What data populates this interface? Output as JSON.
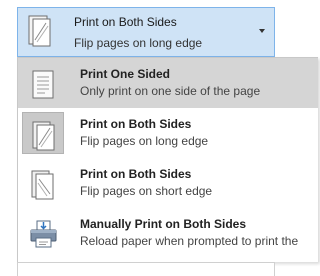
{
  "dropdown": {
    "title": "Print on Both Sides",
    "subtitle": "Flip pages on long edge",
    "icon": "duplex-long-edge-icon"
  },
  "menu": {
    "items": [
      {
        "title": "Print One Sided",
        "subtitle": "Only print on one side of the page",
        "icon": "single-sided-page-icon"
      },
      {
        "title": "Print on Both Sides",
        "subtitle": "Flip pages on long edge",
        "icon": "duplex-long-edge-icon"
      },
      {
        "title": "Print on Both Sides",
        "subtitle": "Flip pages on short edge",
        "icon": "duplex-short-edge-icon"
      },
      {
        "title": "Manually Print on Both Sides",
        "subtitle": "Reload paper when prompted to print the",
        "icon": "printer-manual-duplex-icon"
      }
    ]
  },
  "colors": {
    "dropdown_bg": "#cfe3f6",
    "dropdown_border": "#7eb4ea",
    "hover_bg": "#d5d5d5",
    "selected_icon_bg": "#c9c9c9"
  }
}
